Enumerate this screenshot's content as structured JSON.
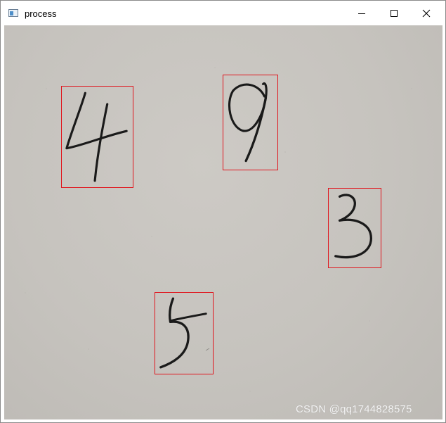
{
  "window": {
    "title": "process",
    "icon": "app-window-icon",
    "controls": [
      "minimize-icon",
      "maximize-icon",
      "close-icon"
    ]
  },
  "detections": [
    {
      "label": "4"
    },
    {
      "label": "9"
    },
    {
      "label": "3"
    },
    {
      "label": "5"
    }
  ],
  "colors": {
    "box_outline": "#e0141c",
    "paper": "#c6c3be",
    "ink": "#1a1a1a"
  },
  "watermark": {
    "text": "CSDN @qq1744828575"
  }
}
